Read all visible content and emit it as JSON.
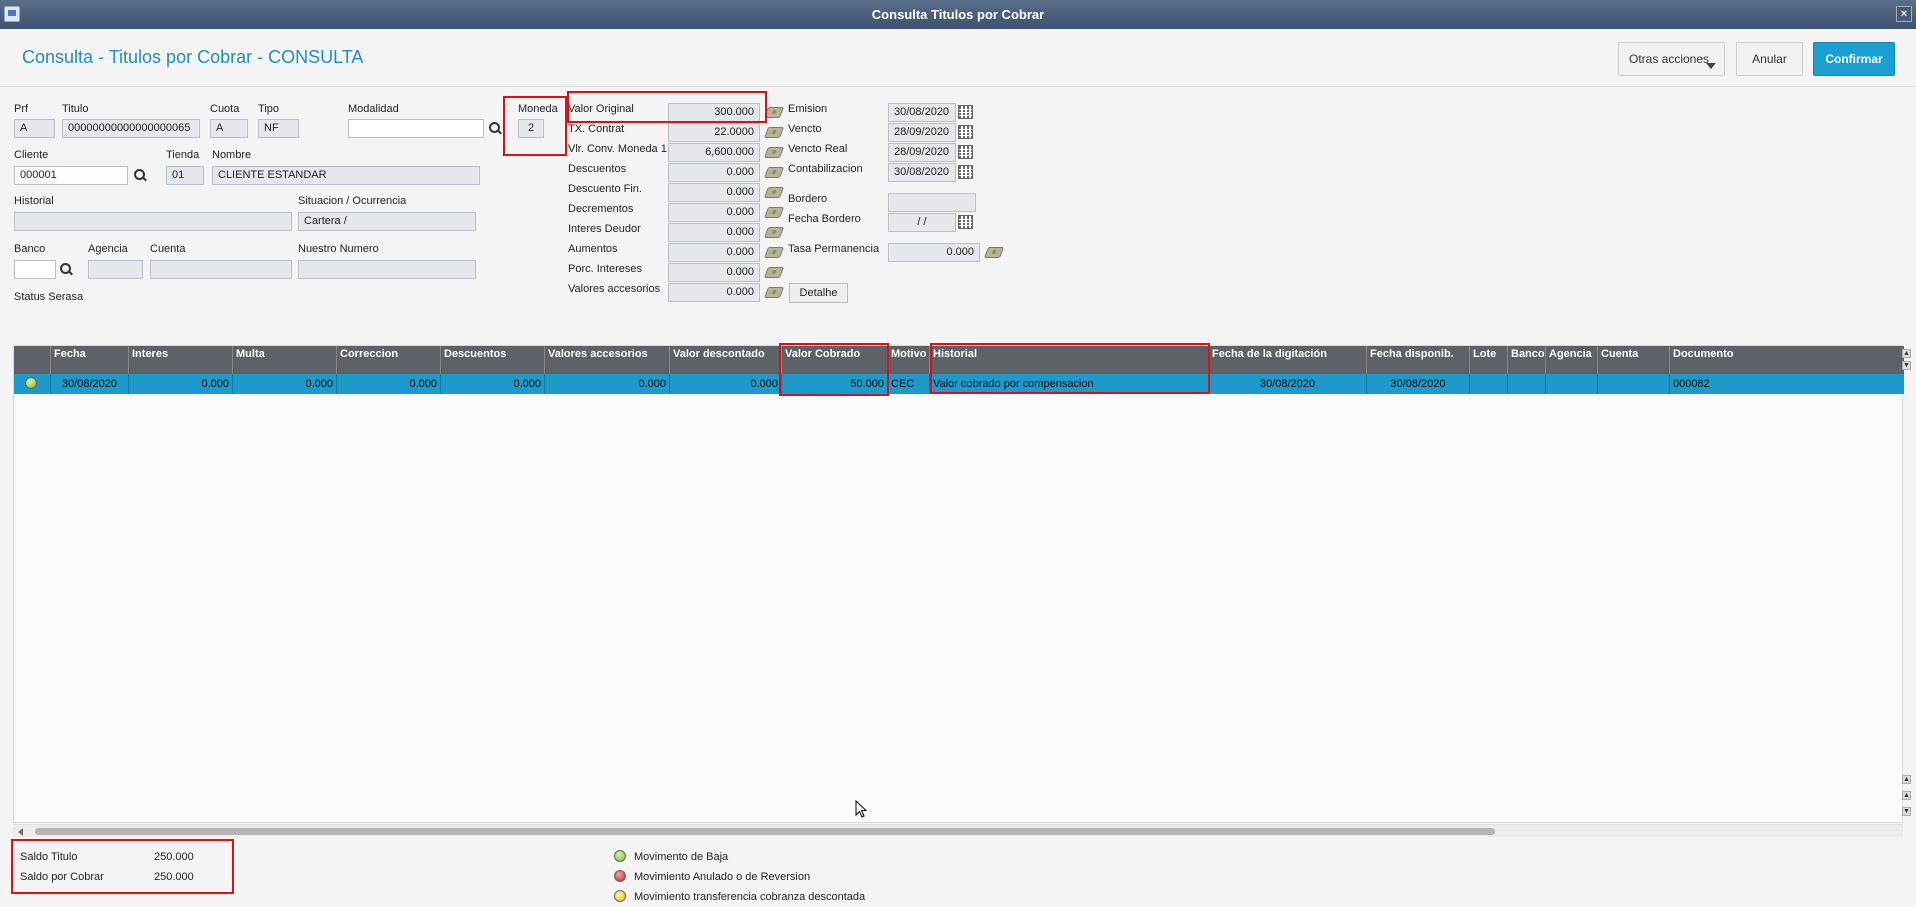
{
  "window": {
    "title": "Consulta Titulos por Cobrar"
  },
  "header": {
    "page_title": "Consulta - Titulos por Cobrar - CONSULTA",
    "otras_acciones": "Otras acciones",
    "anular": "Anular",
    "confirmar": "Confirmar"
  },
  "form": {
    "prf": {
      "label": "Prf",
      "value": "A"
    },
    "titulo": {
      "label": "Titulo",
      "value": "00000000000000000065"
    },
    "cuota": {
      "label": "Cuota",
      "value": "A"
    },
    "tipo": {
      "label": "Tipo",
      "value": "NF"
    },
    "modalidad": {
      "label": "Modalidad",
      "value": ""
    },
    "moneda": {
      "label": "Moneda",
      "value": "2"
    },
    "cliente": {
      "label": "Cliente",
      "value": "000001"
    },
    "tienda": {
      "label": "Tienda",
      "value": "01"
    },
    "nombre": {
      "label": "Nombre",
      "value": "CLIENTE ESTANDAR"
    },
    "historial": {
      "label": "Historial",
      "value": ""
    },
    "situacion": {
      "label": "Situacion / Ocurrencia",
      "value": "Cartera /"
    },
    "banco": {
      "label": "Banco",
      "value": ""
    },
    "agencia": {
      "label": "Agencia",
      "value": ""
    },
    "cuenta": {
      "label": "Cuenta",
      "value": ""
    },
    "nuestro_numero": {
      "label": "Nuestro Numero",
      "value": ""
    },
    "status_serasa": {
      "label": "Status Serasa"
    }
  },
  "values": {
    "valor_original": {
      "label": "Valor Original",
      "value": "300.000"
    },
    "tx_contrat": {
      "label": "TX. Contrat",
      "value": "22.0000"
    },
    "vlr_conv": {
      "label": "Vlr. Conv. Moneda 1",
      "value": "6,600.000"
    },
    "descuentos": {
      "label": "Descuentos",
      "value": "0.000"
    },
    "descuento_fin": {
      "label": "Descuento Fin.",
      "value": "0.000"
    },
    "decrementos": {
      "label": "Decrementos",
      "value": "0.000"
    },
    "interes_deudor": {
      "label": "Interes Deudor",
      "value": "0.000"
    },
    "aumentos": {
      "label": "Aumentos",
      "value": "0.000"
    },
    "porc_intereses": {
      "label": "Porc. Intereses",
      "value": "0.000"
    },
    "valores_accesorios": {
      "label": "Valores accesorios",
      "value": "0.000"
    },
    "detalhe": "Detalhe"
  },
  "dates": {
    "emision": {
      "label": "Emision",
      "value": "30/08/2020"
    },
    "vencto": {
      "label": "Vencto",
      "value": "28/09/2020"
    },
    "vencto_real": {
      "label": "Vencto Real",
      "value": "28/09/2020"
    },
    "contabilizacion": {
      "label": "Contabilizacion",
      "value": "30/08/2020"
    },
    "bordero": {
      "label": "Bordero",
      "value": ""
    },
    "fecha_bordero": {
      "label": "Fecha Bordero",
      "value": "/ /"
    },
    "tasa_permanencia": {
      "label": "Tasa Permanencia",
      "value": "0.000"
    }
  },
  "grid": {
    "columns": [
      "",
      "Fecha",
      "Interes",
      "Multa",
      "Correccion",
      "Descuentos",
      "Valores accesorios",
      "Valor descontado",
      "Valor Cobrado",
      "Motivo",
      "Historial",
      "Fecha de la digitación",
      "Fecha disponib.",
      "Lote",
      "Banco",
      "Agencia",
      "Cuenta",
      "Documento"
    ],
    "rows": [
      [
        "",
        "30/08/2020",
        "0.000",
        "0.000",
        "0.000",
        "0.000",
        "0.000",
        "0.000",
        "50.000",
        "CEC",
        "Valor cobrado por compensacion",
        "30/08/2020",
        "30/08/2020",
        "",
        "",
        "",
        "",
        "000082"
      ]
    ]
  },
  "footer": {
    "saldo_titulo": {
      "label": "Saldo Titulo",
      "value": "250.000"
    },
    "saldo_por_cobrar": {
      "label": "Saldo por Cobrar",
      "value": "250.000"
    },
    "legend": [
      {
        "label": "Movimento de Baja",
        "color": "#6fbe2d"
      },
      {
        "label": "Movimiento Anulado o de Reversion",
        "color": "#d32020"
      },
      {
        "label": "Movimiento transferencia cobranza descontada",
        "color": "#e0c400"
      }
    ]
  }
}
